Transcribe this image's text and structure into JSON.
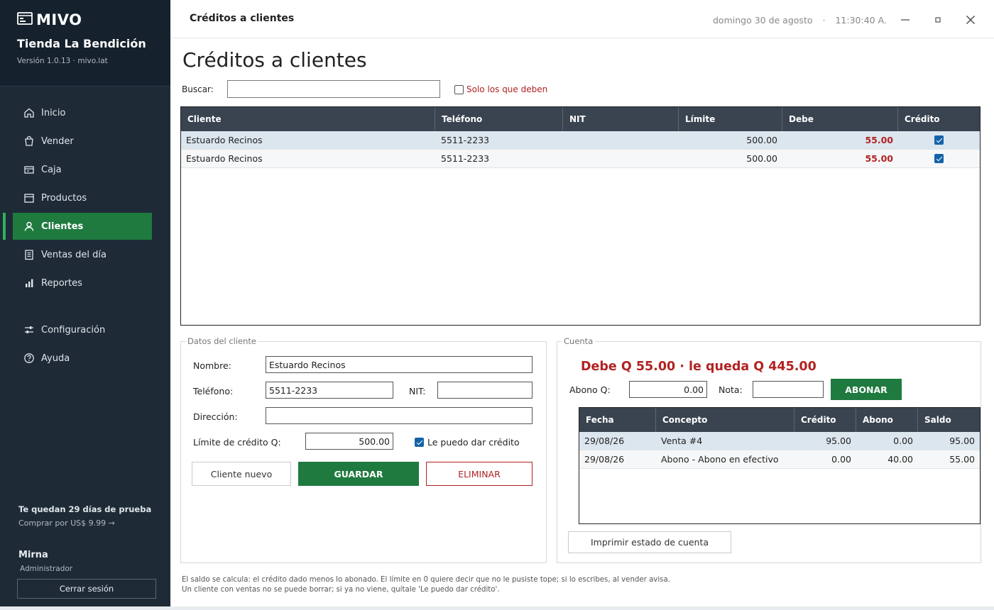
{
  "sidebar": {
    "logo_text": "MIVO",
    "store_name": "Tienda La Bendición",
    "version": "Versión 1.0.13 · mivo.lat",
    "items": [
      {
        "label": "Inicio",
        "icon": "home-icon"
      },
      {
        "label": "Vender",
        "icon": "bag-icon"
      },
      {
        "label": "Caja",
        "icon": "cash-register-icon"
      },
      {
        "label": "Productos",
        "icon": "box-icon"
      },
      {
        "label": "Clientes",
        "icon": "user-icon",
        "active": true
      },
      {
        "label": "Ventas del día",
        "icon": "receipt-icon"
      },
      {
        "label": "Reportes",
        "icon": "bar-chart-icon"
      },
      {
        "label": "Configuración",
        "icon": "sliders-icon"
      },
      {
        "label": "Ayuda",
        "icon": "help-icon"
      }
    ],
    "trial_text": "Te quedan 29 días de prueba",
    "buy_text": "Comprar por US$ 9.99 →",
    "user_name": "Mirna",
    "user_role": "Administrador",
    "logout_label": "Cerrar sesión"
  },
  "topbar": {
    "title": "Créditos a clientes",
    "date": "domingo 30 de agosto",
    "separator": "·",
    "time": "11:30:40 A."
  },
  "page": {
    "title": "Créditos a clientes",
    "search_label": "Buscar:",
    "search_value": "",
    "filter_label": "Solo los que deben",
    "filter_checked": false
  },
  "clients_table": {
    "columns": [
      "Cliente",
      "Teléfono",
      "NIT",
      "Límite",
      "Debe",
      "Crédito"
    ],
    "rows": [
      {
        "cliente": "Estuardo Recinos",
        "telefono": "5511-2233",
        "nit": "",
        "limite": "500.00",
        "debe": "55.00",
        "credito": true
      },
      {
        "cliente": "Estuardo Recinos",
        "telefono": "5511-2233",
        "nit": "",
        "limite": "500.00",
        "debe": "55.00",
        "credito": true
      }
    ]
  },
  "client_form": {
    "legend": "Datos del cliente",
    "name_label": "Nombre:",
    "name_value": "Estuardo Recinos",
    "phone_label": "Teléfono:",
    "phone_value": "5511-2233",
    "nit_label": "NIT:",
    "nit_value": "",
    "address_label": "Dirección:",
    "address_value": "",
    "limit_label": "Límite de crédito Q:",
    "limit_value": "500.00",
    "credit_label": "Le puedo dar crédito",
    "credit_checked": true,
    "new_label": "Cliente nuevo",
    "save_label": "GUARDAR",
    "delete_label": "ELIMINAR"
  },
  "account": {
    "legend": "Cuenta",
    "summary": "Debe Q 55.00   ·   le queda Q 445.00",
    "payment_label": "Abono Q:",
    "payment_value": "0.00",
    "note_label": "Nota:",
    "note_value": "",
    "pay_button": "ABONAR",
    "columns": [
      "Fecha",
      "Concepto",
      "Crédito",
      "Abono",
      "Saldo"
    ],
    "rows": [
      {
        "fecha": "29/08/26",
        "concepto": "Venta #4",
        "credito": "95.00",
        "abono": "0.00",
        "saldo": "95.00"
      },
      {
        "fecha": "29/08/26",
        "concepto": "Abono - Abono en efectivo",
        "credito": "0.00",
        "abono": "40.00",
        "saldo": "55.00"
      }
    ],
    "print_label": "Imprimir estado de cuenta"
  },
  "footnote": {
    "line1": "El saldo se calcula: el crédito dado menos lo abonado. El límite en 0 quiere decir que no le pusiste tope; si lo escribes, al vender avisa.",
    "line2": "Un cliente con ventas no se puede borrar; si ya no viene, quítale 'Le puedo dar crédito'."
  },
  "colors": {
    "sidebar_bg": "#1e2a36",
    "accent_green": "#1f7a3f",
    "debt_red": "#b22222",
    "grid_header": "#3a4450"
  }
}
